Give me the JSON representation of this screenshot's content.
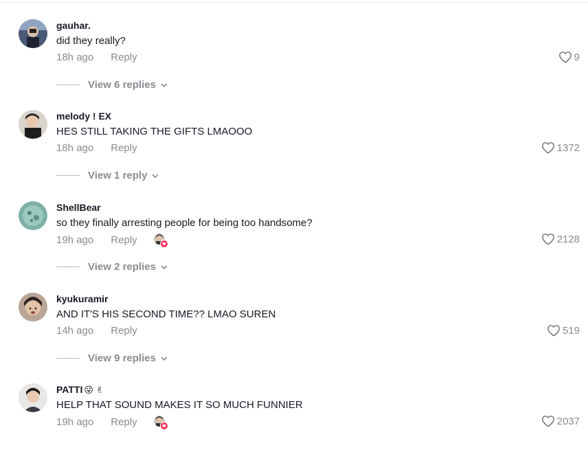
{
  "comments": [
    {
      "username": "gauhar.",
      "username_emoji": "",
      "text": "did they really?",
      "time": "18h ago",
      "reply_label": "Reply",
      "creator_liked": false,
      "likes": "9",
      "view_replies": "View 6 replies"
    },
    {
      "username": "melody ! EX",
      "username_emoji": "",
      "text": "HES STILL TAKING THE GIFTS LMAOOO",
      "time": "18h ago",
      "reply_label": "Reply",
      "creator_liked": false,
      "likes": "1372",
      "view_replies": "View 1 reply"
    },
    {
      "username": "ShellBear",
      "username_emoji": "",
      "text": "so they finally arresting people for being too handsome?",
      "time": "19h ago",
      "reply_label": "Reply",
      "creator_liked": true,
      "likes": "2128",
      "view_replies": "View 2 replies"
    },
    {
      "username": "kyukuramir",
      "username_emoji": "",
      "text": "AND IT'S HIS SECOND TIME?? LMAO SUREN",
      "time": "14h ago",
      "reply_label": "Reply",
      "creator_liked": false,
      "likes": "519",
      "view_replies": "View 9 replies"
    },
    {
      "username": "PATTI",
      "username_emoji": "😜 ✌",
      "text": "HELP THAT SOUND MAKES IT SO MUCH FUNNIER",
      "time": "19h ago",
      "reply_label": "Reply",
      "creator_liked": true,
      "likes": "2037",
      "view_replies": ""
    }
  ],
  "colors": {
    "text_primary": "#161823",
    "text_secondary": "#8a8b91",
    "accent": "#fe2c55"
  },
  "icons": {
    "like": "heart-outline-icon",
    "expand": "chevron-down-icon"
  }
}
